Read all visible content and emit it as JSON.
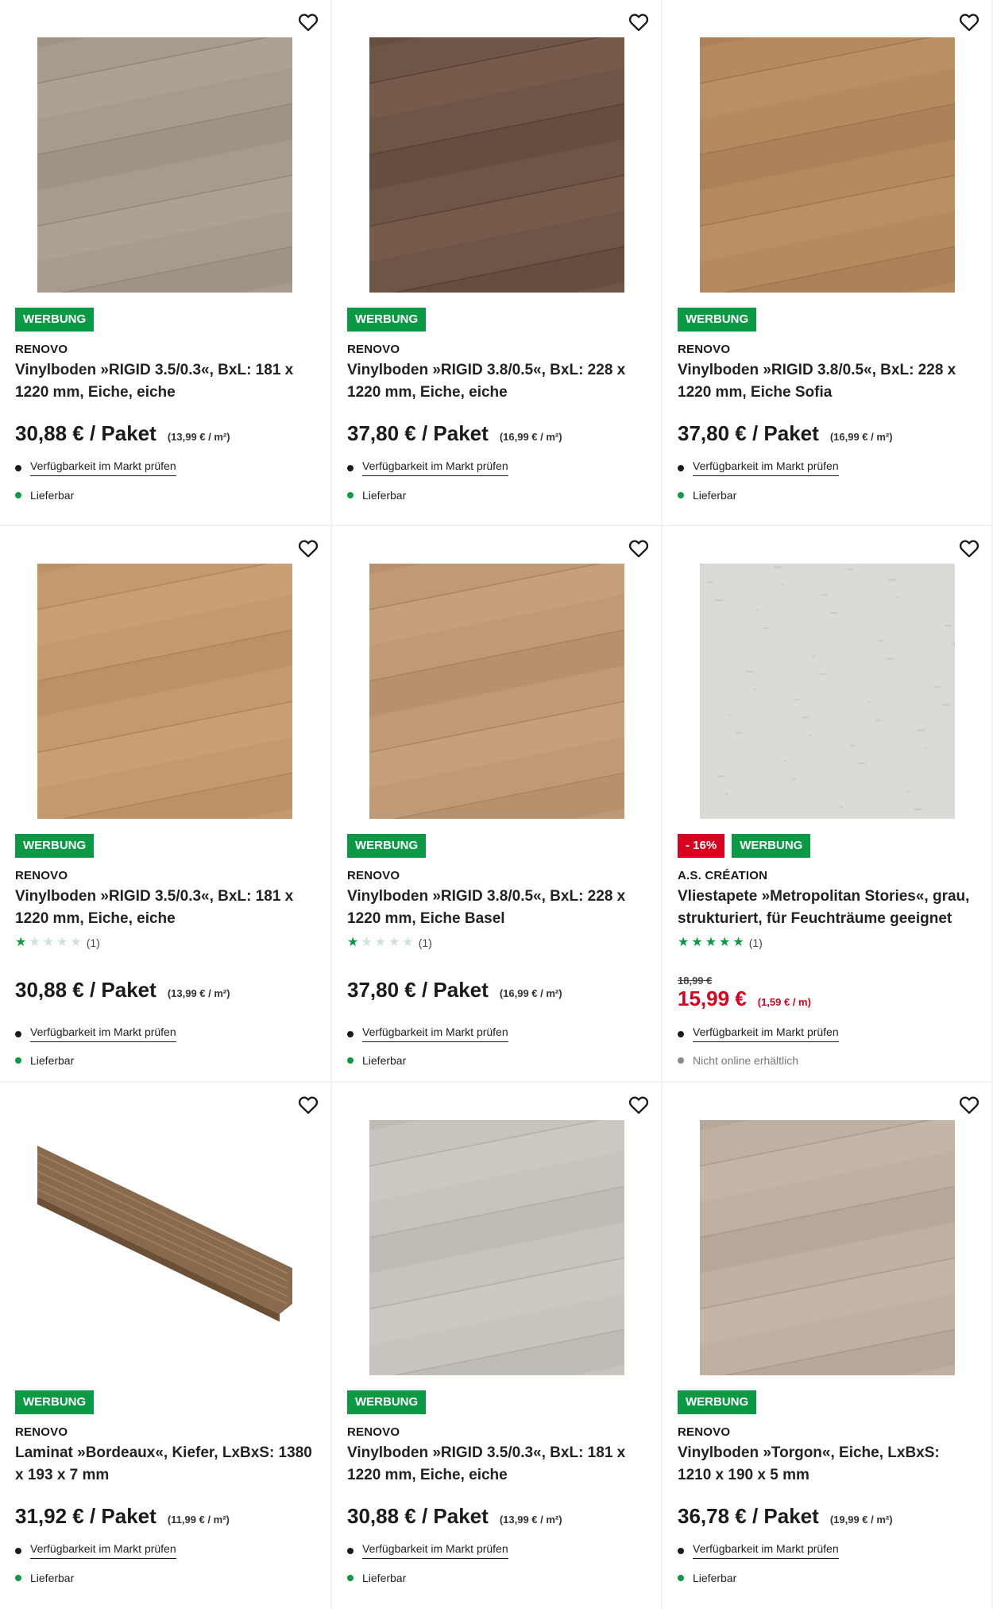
{
  "labels": {
    "ad_badge": "WERBUNG",
    "check_store": "Verfügbarkeit im Markt prüfen",
    "deliverable": "Lieferbar",
    "not_online": "Nicht online erhältlich"
  },
  "colors": {
    "green": "#0a9a44",
    "sale_red": "#d8001e"
  },
  "products": [
    {
      "brand": "RENOVO",
      "title": "Vinylboden »RIGID 3.5/0.3«, BxL: 181 x 1220 mm, Eiche, eiche",
      "price": "30,88 € / Paket",
      "unit_price": "(13,99 € / m²)",
      "availability": "Lieferbar",
      "image": {
        "base": "#a59c8f",
        "light": "#b7ae9f",
        "dark": "#8e8577"
      }
    },
    {
      "brand": "RENOVO",
      "title": "Vinylboden »RIGID 3.8/0.5«, BxL: 228 x 1220 mm, Eiche, eiche",
      "price": "37,80 € / Paket",
      "unit_price": "(16,99 € / m²)",
      "availability": "Lieferbar",
      "image": {
        "base": "#6f5545",
        "light": "#836654",
        "dark": "#553f33"
      }
    },
    {
      "brand": "RENOVO",
      "title": "Vinylboden »RIGID 3.8/0.5«, BxL: 228 x 1220 mm, Eiche Sofia",
      "price": "37,80 € / Paket",
      "unit_price": "(16,99 € / m²)",
      "availability": "Lieferbar",
      "image": {
        "base": "#b48a5e",
        "light": "#c39c70",
        "dark": "#9c744b"
      }
    },
    {
      "brand": "RENOVO",
      "title": "Vinylboden »RIGID 3.5/0.3«, BxL: 181 x 1220 mm, Eiche, eiche",
      "rating": {
        "value": 1,
        "count": "(1)"
      },
      "price": "30,88 € / Paket",
      "unit_price": "(13,99 € / m²)",
      "availability": "Lieferbar",
      "image": {
        "base": "#c39a6c",
        "light": "#d1ab80",
        "dark": "#aa8459"
      }
    },
    {
      "brand": "RENOVO",
      "title": "Vinylboden »RIGID 3.8/0.5«, BxL: 228 x 1220 mm, Eiche Basel",
      "rating": {
        "value": 1,
        "count": "(1)"
      },
      "price": "37,80 € / Paket",
      "unit_price": "(16,99 € / m²)",
      "availability": "Lieferbar",
      "image": {
        "base": "#c09a74",
        "light": "#cfac88",
        "dark": "#a6825f"
      }
    },
    {
      "brand": "A.S. CRÉATION",
      "discount": "- 16%",
      "title": "Vliestapete »Metropolitan Stories«, grau, strukturiert, für Feuchträume geeignet",
      "rating": {
        "value": 5,
        "count": "(1)"
      },
      "old_price": "18,99 €",
      "price": "15,99 €",
      "unit_price": "(1,59 € / m)",
      "availability": "Nicht online erhältlich",
      "image": {
        "base": "#d9dbd7",
        "light": "#e6e8e4",
        "dark": "#b9bcb7"
      }
    },
    {
      "brand": "RENOVO",
      "title": "Laminat »Bordeaux«, Kiefer, LxBxS: 1380 x 193 x 7 mm",
      "price": "31,92 € / Paket",
      "unit_price": "(11,99 € / m²)",
      "availability": "Lieferbar",
      "image": {
        "base": "#8a6a4c",
        "light": "#a0805f",
        "dark": "#6b4f37"
      }
    },
    {
      "brand": "RENOVO",
      "title": "Vinylboden »RIGID 3.5/0.3«, BxL: 181 x 1220 mm, Eiche, eiche",
      "price": "30,88 € / Paket",
      "unit_price": "(13,99 € / m²)",
      "availability": "Lieferbar",
      "image": {
        "base": "#c7c3bd",
        "light": "#d6d3ce",
        "dark": "#b0aca5"
      }
    },
    {
      "brand": "RENOVO",
      "title": "Vinylboden »Torgon«, Eiche, LxBxS: 1210 x 190 x 5 mm",
      "price": "36,78 € / Paket",
      "unit_price": "(19,99 € / m²)",
      "availability": "Lieferbar",
      "image": {
        "base": "#bfb1a2",
        "light": "#ccc0b3",
        "dark": "#a6988a"
      }
    }
  ]
}
